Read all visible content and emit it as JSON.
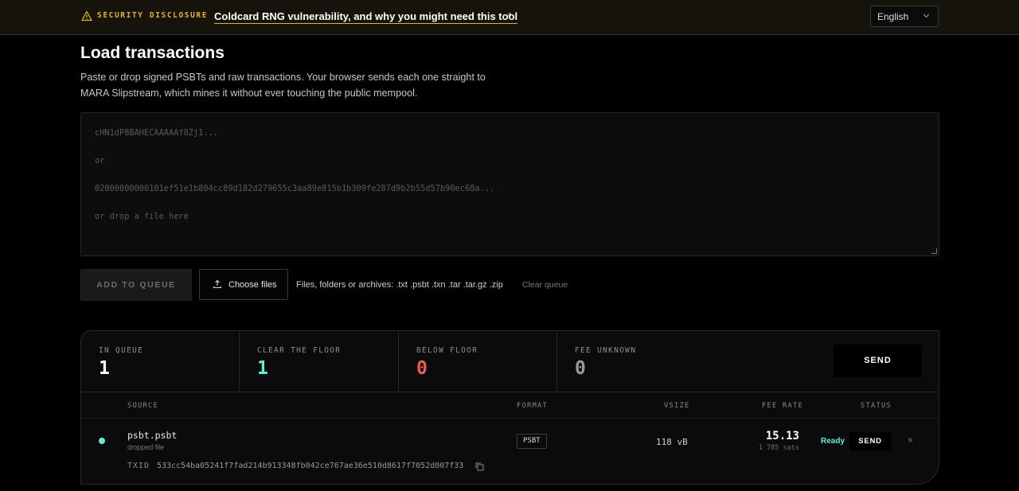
{
  "banner": {
    "label": "SECURITY DISCLOSURE",
    "link_text": "Coldcard RNG vulnerability, and why you might need this tool",
    "warn_icon": "warning-triangle-icon",
    "ext_icon": "↗"
  },
  "language": {
    "selected": "English"
  },
  "page": {
    "title": "Load transactions",
    "description": "Paste or drop signed PSBTs and raw transactions. Your browser sends each one straight to MARA Slipstream, which mines it without ever touching the public mempool."
  },
  "paste_area": {
    "placeholder_lines": [
      "cHN1dP8BAHECAAAAAf8Zj1...",
      "or",
      "02000000000101ef51e1b804cc89d182d279655c3aa89e815b1b309fe287d9b2b55d57b90ec68a...",
      "or drop a file here"
    ]
  },
  "actions": {
    "add_to_queue": "ADD TO QUEUE",
    "choose_files": "Choose files",
    "hint": "Files, folders or archives: .txt .psbt .txn .tar .tar.gz .zip",
    "clear_queue": "Clear queue"
  },
  "stats": [
    {
      "label": "IN QUEUE",
      "value": "1",
      "color": "#ffffff"
    },
    {
      "label": "CLEAR THE FLOOR",
      "value": "1",
      "color": "#6ee9d8"
    },
    {
      "label": "BELOW FLOOR",
      "value": "0",
      "color": "#ef5a5a"
    },
    {
      "label": "FEE UNKNOWN",
      "value": "0",
      "color": "#9a9a9a"
    }
  ],
  "send_all": "SEND",
  "table": {
    "headers": {
      "source": "SOURCE",
      "format": "FORMAT",
      "vsize": "VSIZE",
      "fee_rate": "FEE RATE",
      "status": "STATUS"
    },
    "rows": [
      {
        "source": "psbt.psbt",
        "source_sub": "dropped file",
        "format": "PSBT",
        "vsize": "118 vB",
        "fee_rate": "15.13",
        "fee_sats": "1 785 sats",
        "status": "Ready",
        "send": "SEND",
        "remove": "×",
        "txid_label": "TXID",
        "txid": "533cc54ba05241f7fad214b913348fb042ce767ae36e510d8617f7052d007f33"
      }
    ]
  }
}
